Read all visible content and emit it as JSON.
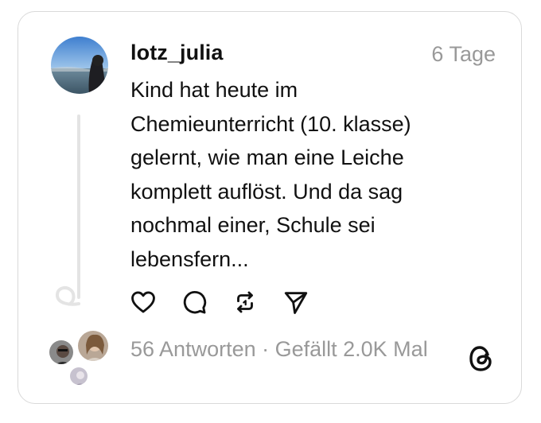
{
  "post": {
    "username": "lotz_julia",
    "time": "6 Tage",
    "text": "Kind hat heute im\nChemieunterricht (10. klasse)\ngelernt, wie man eine Leiche\nkomplett auflöst. Und da sag\nnochmal einer, Schule sei\nlebensfern...",
    "stats": "56 Antworten · Gefällt 2.0K Mal"
  },
  "actions": [
    {
      "name": "like",
      "icon": "heart-icon"
    },
    {
      "name": "reply",
      "icon": "comment-icon"
    },
    {
      "name": "repost",
      "icon": "repost-icon"
    },
    {
      "name": "share",
      "icon": "send-icon"
    }
  ],
  "brand": {
    "logo": "threads-logo-icon"
  },
  "colors": {
    "text": "#111111",
    "muted": "#999999",
    "border": "#d9d9d9",
    "thread_line": "#e4e4e4"
  }
}
